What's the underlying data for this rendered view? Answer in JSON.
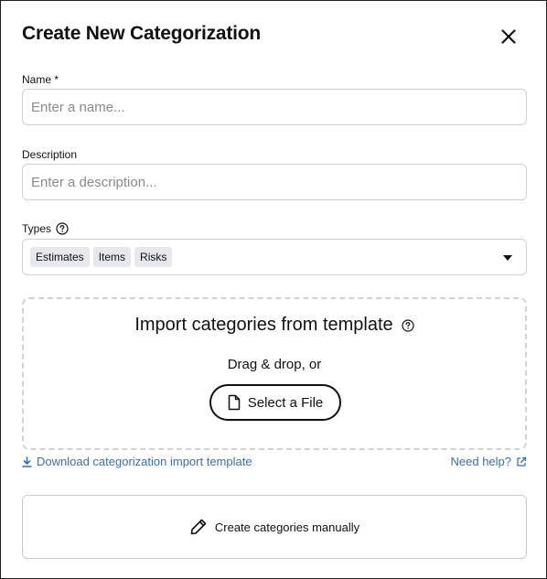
{
  "dialog": {
    "title": "Create New Categorization",
    "close_icon": "close-icon"
  },
  "name_field": {
    "label": "Name *",
    "placeholder": "Enter a name...",
    "value": ""
  },
  "description_field": {
    "label": "Description",
    "placeholder": "Enter a description...",
    "value": ""
  },
  "types_field": {
    "label": "Types",
    "help_icon": "help-circle-icon",
    "chips": [
      "Estimates",
      "Items",
      "Risks"
    ],
    "dropdown_icon": "caret-down-icon"
  },
  "import": {
    "title": "Import categories from template",
    "help_icon": "help-circle-icon",
    "subtitle": "Drag & drop, or",
    "select_file_label": "Select a File",
    "file_icon": "file-icon"
  },
  "links": {
    "download_label": "Download categorization import template",
    "download_icon": "download-icon",
    "help_label": "Need help?",
    "help_icon": "external-link-icon"
  },
  "manual": {
    "label": "Create categories manually",
    "icon": "pencil-icon"
  },
  "colors": {
    "link": "#3f6fa8",
    "chip_bg": "#e6e8ec",
    "border": "#cfcfcf",
    "text": "#111111"
  }
}
